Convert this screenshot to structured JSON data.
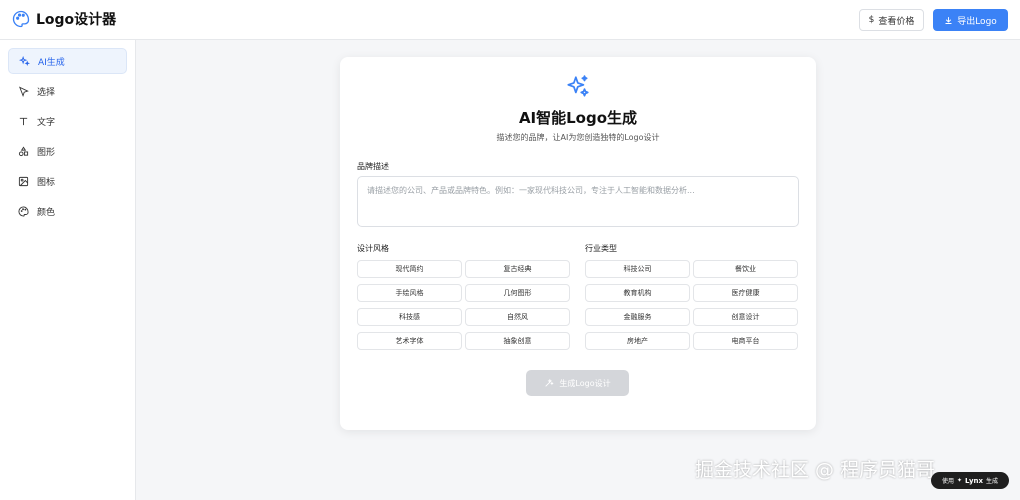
{
  "header": {
    "title": "Logo设计器",
    "price_button": "查看价格",
    "export_button": "导出Logo"
  },
  "sidebar": {
    "items": [
      {
        "label": "AI生成",
        "icon": "sparkles-icon",
        "active": true
      },
      {
        "label": "选择",
        "icon": "cursor-icon",
        "active": false
      },
      {
        "label": "文字",
        "icon": "text-icon",
        "active": false
      },
      {
        "label": "图形",
        "icon": "shapes-icon",
        "active": false
      },
      {
        "label": "图标",
        "icon": "image-icon",
        "active": false
      },
      {
        "label": "颜色",
        "icon": "palette-icon",
        "active": false
      }
    ]
  },
  "main": {
    "title": "AI智能Logo生成",
    "subtitle": "描述您的品牌，让AI为您创造独特的Logo设计",
    "brand_label": "品牌描述",
    "brand_placeholder": "请描述您的公司、产品或品牌特色。例如：一家现代科技公司，专注于人工智能和数据分析...",
    "brand_value": "",
    "style_label": "设计风格",
    "styles": [
      "现代简约",
      "复古经典",
      "手绘风格",
      "几何图形",
      "科技感",
      "自然风",
      "艺术字体",
      "抽象创意"
    ],
    "industry_label": "行业类型",
    "industries": [
      "科技公司",
      "餐饮业",
      "教育机构",
      "医疗健康",
      "金融服务",
      "创意设计",
      "房地产",
      "电商平台"
    ],
    "generate_button": "生成Logo设计"
  },
  "watermark": {
    "text": "掘金技术社区 @ 程序员猫哥",
    "badge_prefix": "使用",
    "badge_brand": "Lynx",
    "badge_suffix": "生成"
  },
  "colors": {
    "accent": "#3b82f6",
    "active_bg": "#eef4fd",
    "disabled_button": "#d4d6da"
  }
}
